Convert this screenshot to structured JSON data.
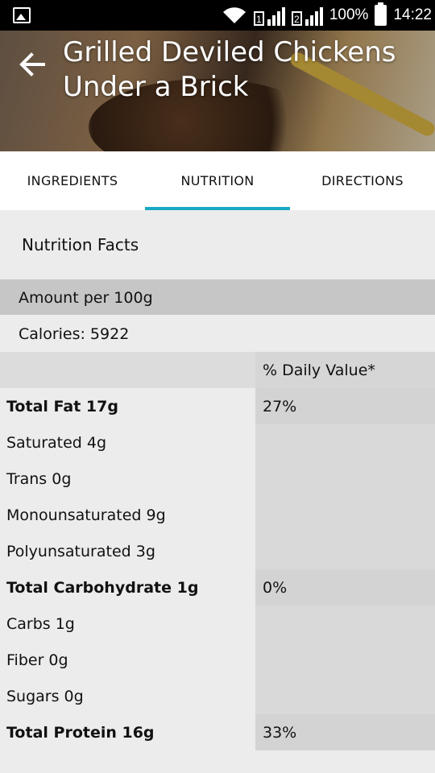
{
  "status_bar": {
    "sim1": "1",
    "sim2": "2",
    "battery": "100%",
    "time": "14:22"
  },
  "header": {
    "title": "Grilled Deviled Chickens Under a Brick"
  },
  "tabs": [
    {
      "label": "INGREDIENTS",
      "active": false
    },
    {
      "label": "NUTRITION",
      "active": true
    },
    {
      "label": "DIRECTIONS",
      "active": false
    }
  ],
  "nutrition": {
    "title": "Nutrition Facts",
    "amount": "Amount per 100g",
    "calories": "Calories: 5922",
    "dv_header": "% Daily Value*",
    "rows": [
      {
        "name": "Total Fat 17g",
        "dv": "27%",
        "bold": true
      },
      {
        "name": "Saturated 4g",
        "dv": "",
        "bold": false
      },
      {
        "name": "Trans 0g",
        "dv": "",
        "bold": false
      },
      {
        "name": "Monounsaturated 9g",
        "dv": "",
        "bold": false
      },
      {
        "name": "Polyunsaturated 3g",
        "dv": "",
        "bold": false
      },
      {
        "name": "Total Carbohydrate 1g",
        "dv": "0%",
        "bold": true
      },
      {
        "name": "Carbs 1g",
        "dv": "",
        "bold": false
      },
      {
        "name": "Fiber 0g",
        "dv": "",
        "bold": false
      },
      {
        "name": "Sugars 0g",
        "dv": "",
        "bold": false
      },
      {
        "name": "Total Protein 16g",
        "dv": "33%",
        "bold": true
      }
    ]
  },
  "colors": {
    "accent": "#1aa9c4",
    "background": "#ececec"
  }
}
